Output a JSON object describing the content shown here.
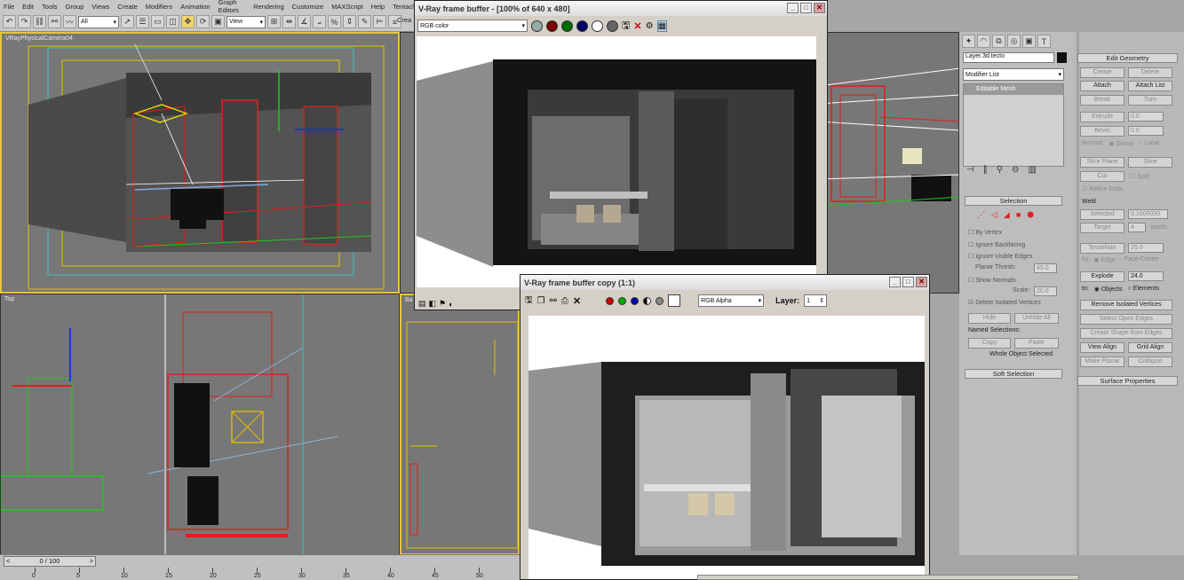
{
  "menu": [
    "File",
    "Edit",
    "Tools",
    "Group",
    "Views",
    "Create",
    "Modifiers",
    "Animation",
    "Graph Editors",
    "Rendering",
    "Customize",
    "MAXScript",
    "Help",
    "Tentacle"
  ],
  "toolbar": {
    "selection_filter": "All",
    "ref_coord": "View",
    "create_label": "Crea"
  },
  "viewports": {
    "camera_label": "VRayPhysicalCamera04",
    "top_label": "Top",
    "persp_label": "",
    "back_label": "Ba"
  },
  "vfb": {
    "title": "V-Ray frame buffer - [100% of 640 x 480]",
    "channel": "RGB color",
    "colors": {
      "red": "#7a0000",
      "green": "#006a00",
      "blue": "#000060"
    }
  },
  "vfb_copy": {
    "title": "V-Ray frame buffer copy (1:1)",
    "channel": "RGB Alpha",
    "layer_label": "Layer:",
    "layer_value": "1"
  },
  "modify": {
    "object_name": "Layer.3d.tecto",
    "modifier_list": "Modifier List",
    "stack_item": "Editable Mesh",
    "selection_title": "Selection",
    "by_vertex": "By Vertex",
    "ignore_backfacing": "Ignore Backfacing",
    "ignore_visible_edges": "Ignore Visible Edges",
    "planar_thresh_label": "Planar Thresh:",
    "planar_thresh": "45.0",
    "show_normals": "Show Normals",
    "scale_label": "Scale:",
    "scale": "20.0",
    "delete_isolated": "Delete Isolated Vertices",
    "hide": "Hide",
    "unhide_all": "Unhide All",
    "named_selections": "Named Selections:",
    "copy": "Copy",
    "paste": "Paste",
    "whole_object": "Whole Object Selected",
    "soft_selection": "Soft Selection"
  },
  "edit_geometry": {
    "title": "Edit Geometry",
    "create": "Create",
    "delete": "Delete",
    "attach": "Attach",
    "attach_list": "Attach List",
    "break": "Break",
    "turn": "Turn",
    "extrude": "Extrude",
    "extrude_val": "0.0",
    "bevel": "Bevel",
    "bevel_val": "0.0",
    "normal": "Normal:",
    "group": "Group",
    "local": "Local",
    "slice_plane": "Slice Plane",
    "slice": "Slice",
    "cut": "Cut",
    "split": "Split",
    "refine_ends": "Refine Ends",
    "weld": "Weld",
    "selected": "Selected",
    "selected_val": "0.1000000",
    "target": "Target",
    "target_val": "4",
    "pixels": "pixels",
    "tessellate": "Tessellate",
    "tess_val": "25.0",
    "by": "by:",
    "edge": "Edge",
    "face_center": "Face-Center",
    "explode": "Explode",
    "explode_val": "24.0",
    "to": "to:",
    "objects": "Objects",
    "elements": "Elements",
    "remove_isolated": "Remove Isolated Vertices",
    "select_open_edges": "Select Open Edges",
    "create_shape": "Create Shape from Edges",
    "view_align": "View Align",
    "grid_align": "Grid Align",
    "make_planar": "Make Planar",
    "collapse": "Collapse",
    "surface_props": "Surface Properties"
  },
  "timeline": {
    "frame": "0 / 100",
    "ticks": [
      "0",
      "5",
      "10",
      "15",
      "20",
      "25",
      "30",
      "35",
      "40",
      "45",
      "50"
    ]
  }
}
